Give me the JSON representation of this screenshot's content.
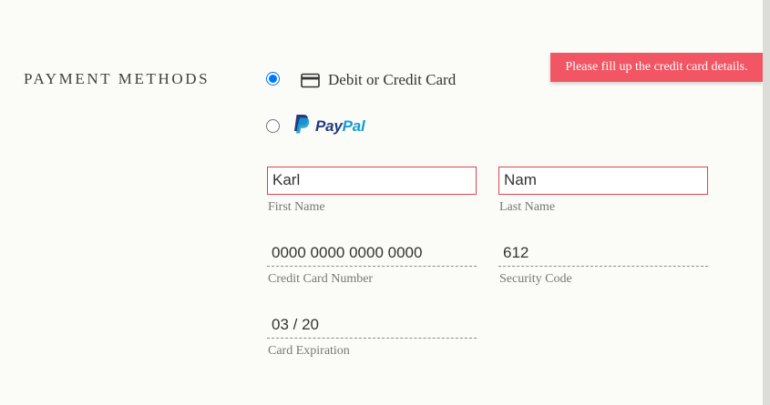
{
  "payment": {
    "title": "PAYMENT METHODS",
    "options": [
      {
        "label": "Debit or Credit Card",
        "selected": true,
        "icon": "credit-card-icon"
      },
      {
        "label_pay": "Pay",
        "label_pal": "Pal",
        "selected": false,
        "icon": "paypal-logo"
      }
    ],
    "error_tooltip": "Please fill up the credit card details."
  },
  "form": {
    "first_name": {
      "value": "Karl",
      "label": "First Name"
    },
    "last_name": {
      "value": "Nam",
      "label": "Last Name"
    },
    "card_number": {
      "value": "0000 0000 0000 0000",
      "label": "Credit Card Number"
    },
    "security_code": {
      "value": "612",
      "label": "Security Code"
    },
    "expiration": {
      "value": "03 / 20",
      "label": "Card Expiration"
    }
  },
  "colors": {
    "error": "#f25563",
    "radio_accent": "#0075ff",
    "paypal_dark": "#253b80",
    "paypal_light": "#179bd7"
  }
}
